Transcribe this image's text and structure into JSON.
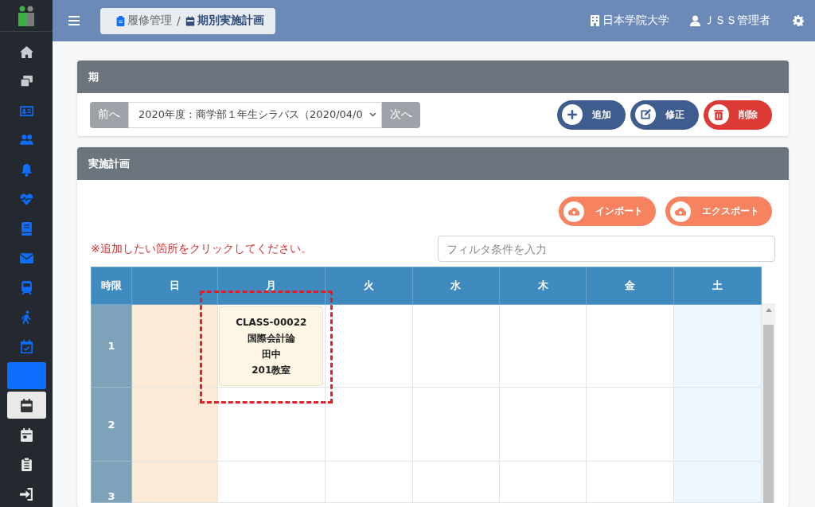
{
  "sidebar": {
    "items": [
      {
        "kind": "icon",
        "selected": false
      },
      {
        "kind": "icon",
        "selected": false
      },
      {
        "kind": "icon",
        "selected": false
      },
      {
        "kind": "icon",
        "selected": false
      },
      {
        "kind": "icon",
        "selected": false
      },
      {
        "kind": "icon",
        "selected": false
      },
      {
        "kind": "icon",
        "selected": false
      },
      {
        "kind": "icon",
        "selected": false
      },
      {
        "kind": "icon",
        "selected": false
      },
      {
        "kind": "icon",
        "selected": false
      },
      {
        "kind": "icon",
        "selected": false
      },
      {
        "kind": "blank",
        "selected": false
      },
      {
        "kind": "icon",
        "selected": true
      },
      {
        "kind": "icon",
        "selected": false
      },
      {
        "kind": "icon",
        "selected": false
      },
      {
        "kind": "icon",
        "selected": false
      }
    ]
  },
  "topbar": {
    "breadcrumb": [
      {
        "text": "履修管理"
      },
      {
        "text": "期別実施計画"
      }
    ],
    "separator": "/",
    "institution": "日本学院大学",
    "user": "ＪＳＳ管理者"
  },
  "period_panel": {
    "title": "期",
    "prev": "前へ",
    "select_value": "2020年度：商学部１年生シラバス（2020/04/0",
    "next": "次へ",
    "buttons": [
      {
        "label": "追加",
        "kind": "add"
      },
      {
        "label": "修正",
        "kind": "edit"
      },
      {
        "label": "削除",
        "kind": "delete"
      }
    ]
  },
  "plan_panel": {
    "title": "実施計画",
    "buttons": [
      {
        "label": "インポート",
        "kind": "import"
      },
      {
        "label": "エクスポート",
        "kind": "export"
      }
    ],
    "notice": "※追加したい箇所をクリックしてください。",
    "filter": {
      "placeholder": "フィルタ条件を入力"
    },
    "timetable": {
      "columns": [
        {
          "label": "時限",
          "kind": "period"
        },
        {
          "label": "日",
          "kind": "sunday"
        },
        {
          "label": "月",
          "kind": "weekday"
        },
        {
          "label": "火",
          "kind": "weekday"
        },
        {
          "label": "水",
          "kind": "weekday"
        },
        {
          "label": "木",
          "kind": "weekday"
        },
        {
          "label": "金",
          "kind": "weekday"
        },
        {
          "label": "土",
          "kind": "saturday"
        }
      ],
      "rows": [
        {
          "cells": [
            {
              "kind": "period",
              "text": "1"
            },
            {
              "kind": "empty"
            },
            {
              "kind": "class",
              "lines": [
                "CLASS-00022",
                "国際会計論",
                "田中",
                "201教室"
              ],
              "highlighted": true
            },
            {
              "kind": "empty"
            },
            {
              "kind": "empty"
            },
            {
              "kind": "empty"
            },
            {
              "kind": "empty"
            },
            {
              "kind": "empty"
            }
          ]
        },
        {
          "cells": [
            {
              "kind": "period",
              "text": "2"
            },
            {
              "kind": "empty"
            },
            {
              "kind": "empty"
            },
            {
              "kind": "empty"
            },
            {
              "kind": "empty"
            },
            {
              "kind": "empty"
            },
            {
              "kind": "empty"
            },
            {
              "kind": "empty"
            }
          ]
        },
        {
          "cells": [
            {
              "kind": "period",
              "text": "3"
            },
            {
              "kind": "empty"
            },
            {
              "kind": "empty"
            },
            {
              "kind": "empty"
            },
            {
              "kind": "empty"
            },
            {
              "kind": "empty"
            },
            {
              "kind": "empty"
            },
            {
              "kind": "empty"
            }
          ]
        }
      ]
    }
  }
}
